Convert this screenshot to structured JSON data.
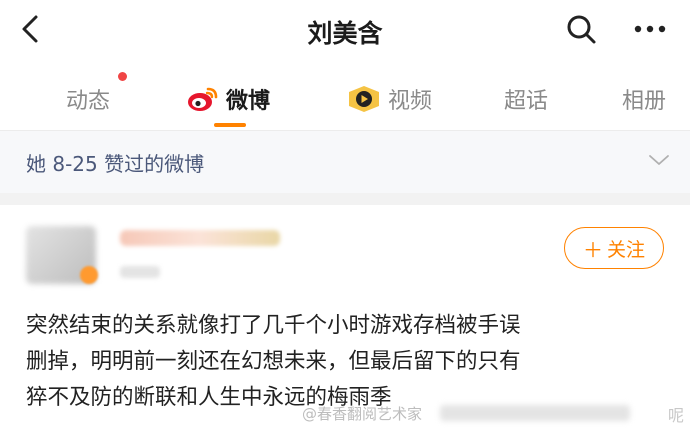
{
  "header": {
    "title": "刘美含",
    "back_icon": "chevron-left-icon",
    "search_icon": "search-icon",
    "more_icon": "more-horizontal-icon"
  },
  "tabs": [
    {
      "label": "动态",
      "has_dot": true
    },
    {
      "label": "微博",
      "active": true,
      "icon": "weibo-logo-icon"
    },
    {
      "label": "视频",
      "icon": "video-channel-icon"
    },
    {
      "label": "超话"
    },
    {
      "label": "相册"
    }
  ],
  "banner": {
    "text": "她 8-25 赞过的微博",
    "icon": "chevron-down-icon"
  },
  "post": {
    "follow_label": "关注",
    "lines": [
      "突然结束的关系就像打了几千个小时游戏存档被手误",
      "删掉，明明前一刻还在幻想未来，但最后留下的只有",
      "猝不及防的断联和人生中永远的梅雨季"
    ]
  },
  "watermark": {
    "text": "@春香翻阅艺术家",
    "tail": "呢"
  },
  "colors": {
    "accent": "#ff8200",
    "notification_dot": "#f04545",
    "banner_text": "#4b587a",
    "banner_bg": "#f7f8fa"
  }
}
